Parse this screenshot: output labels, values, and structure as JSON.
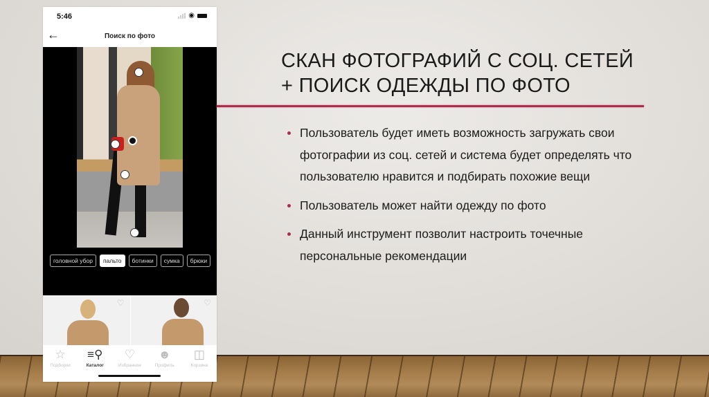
{
  "slide": {
    "title_line1": "СКАН ФОТОГРАФИЙ С СОЦ. СЕТЕЙ",
    "title_line2": "+ ПОИСК ОДЕЖДЫ ПО ФОТО",
    "accent_color": "#a8304d",
    "bullets": [
      "Пользователь будет иметь возможность загружать свои фотографии из соц. сетей и система будет определять что пользователю нравится и подбирать похожие вещи",
      "Пользователь может найти одежду по фото",
      "Данный инструмент позволит настроить точечные персональные рекомендации"
    ]
  },
  "phone": {
    "status_time": "5:46",
    "status_icons": [
      "signal-icon",
      "wifi-icon",
      "battery-icon"
    ],
    "header": {
      "back_icon": "arrow-left-icon",
      "title": "Поиск по фото"
    },
    "tags": [
      {
        "label": "головной убор",
        "selected": false
      },
      {
        "label": "пальто",
        "selected": true
      },
      {
        "label": "ботинки",
        "selected": false
      },
      {
        "label": "сумка",
        "selected": false
      },
      {
        "label": "брюки",
        "selected": false
      }
    ],
    "products": [
      {
        "favorite_icon": "heart-outline-icon"
      },
      {
        "favorite_icon": "heart-outline-icon"
      }
    ],
    "tab_bar": [
      {
        "label": "Подборки",
        "icon": "star-icon",
        "active": false
      },
      {
        "label": "Каталог",
        "icon": "catalog-search-icon",
        "active": true
      },
      {
        "label": "Избранное",
        "icon": "heart-icon",
        "active": false
      },
      {
        "label": "Профиль",
        "icon": "profile-icon",
        "active": false
      },
      {
        "label": "Корзина",
        "icon": "bag-icon",
        "active": false
      }
    ]
  }
}
